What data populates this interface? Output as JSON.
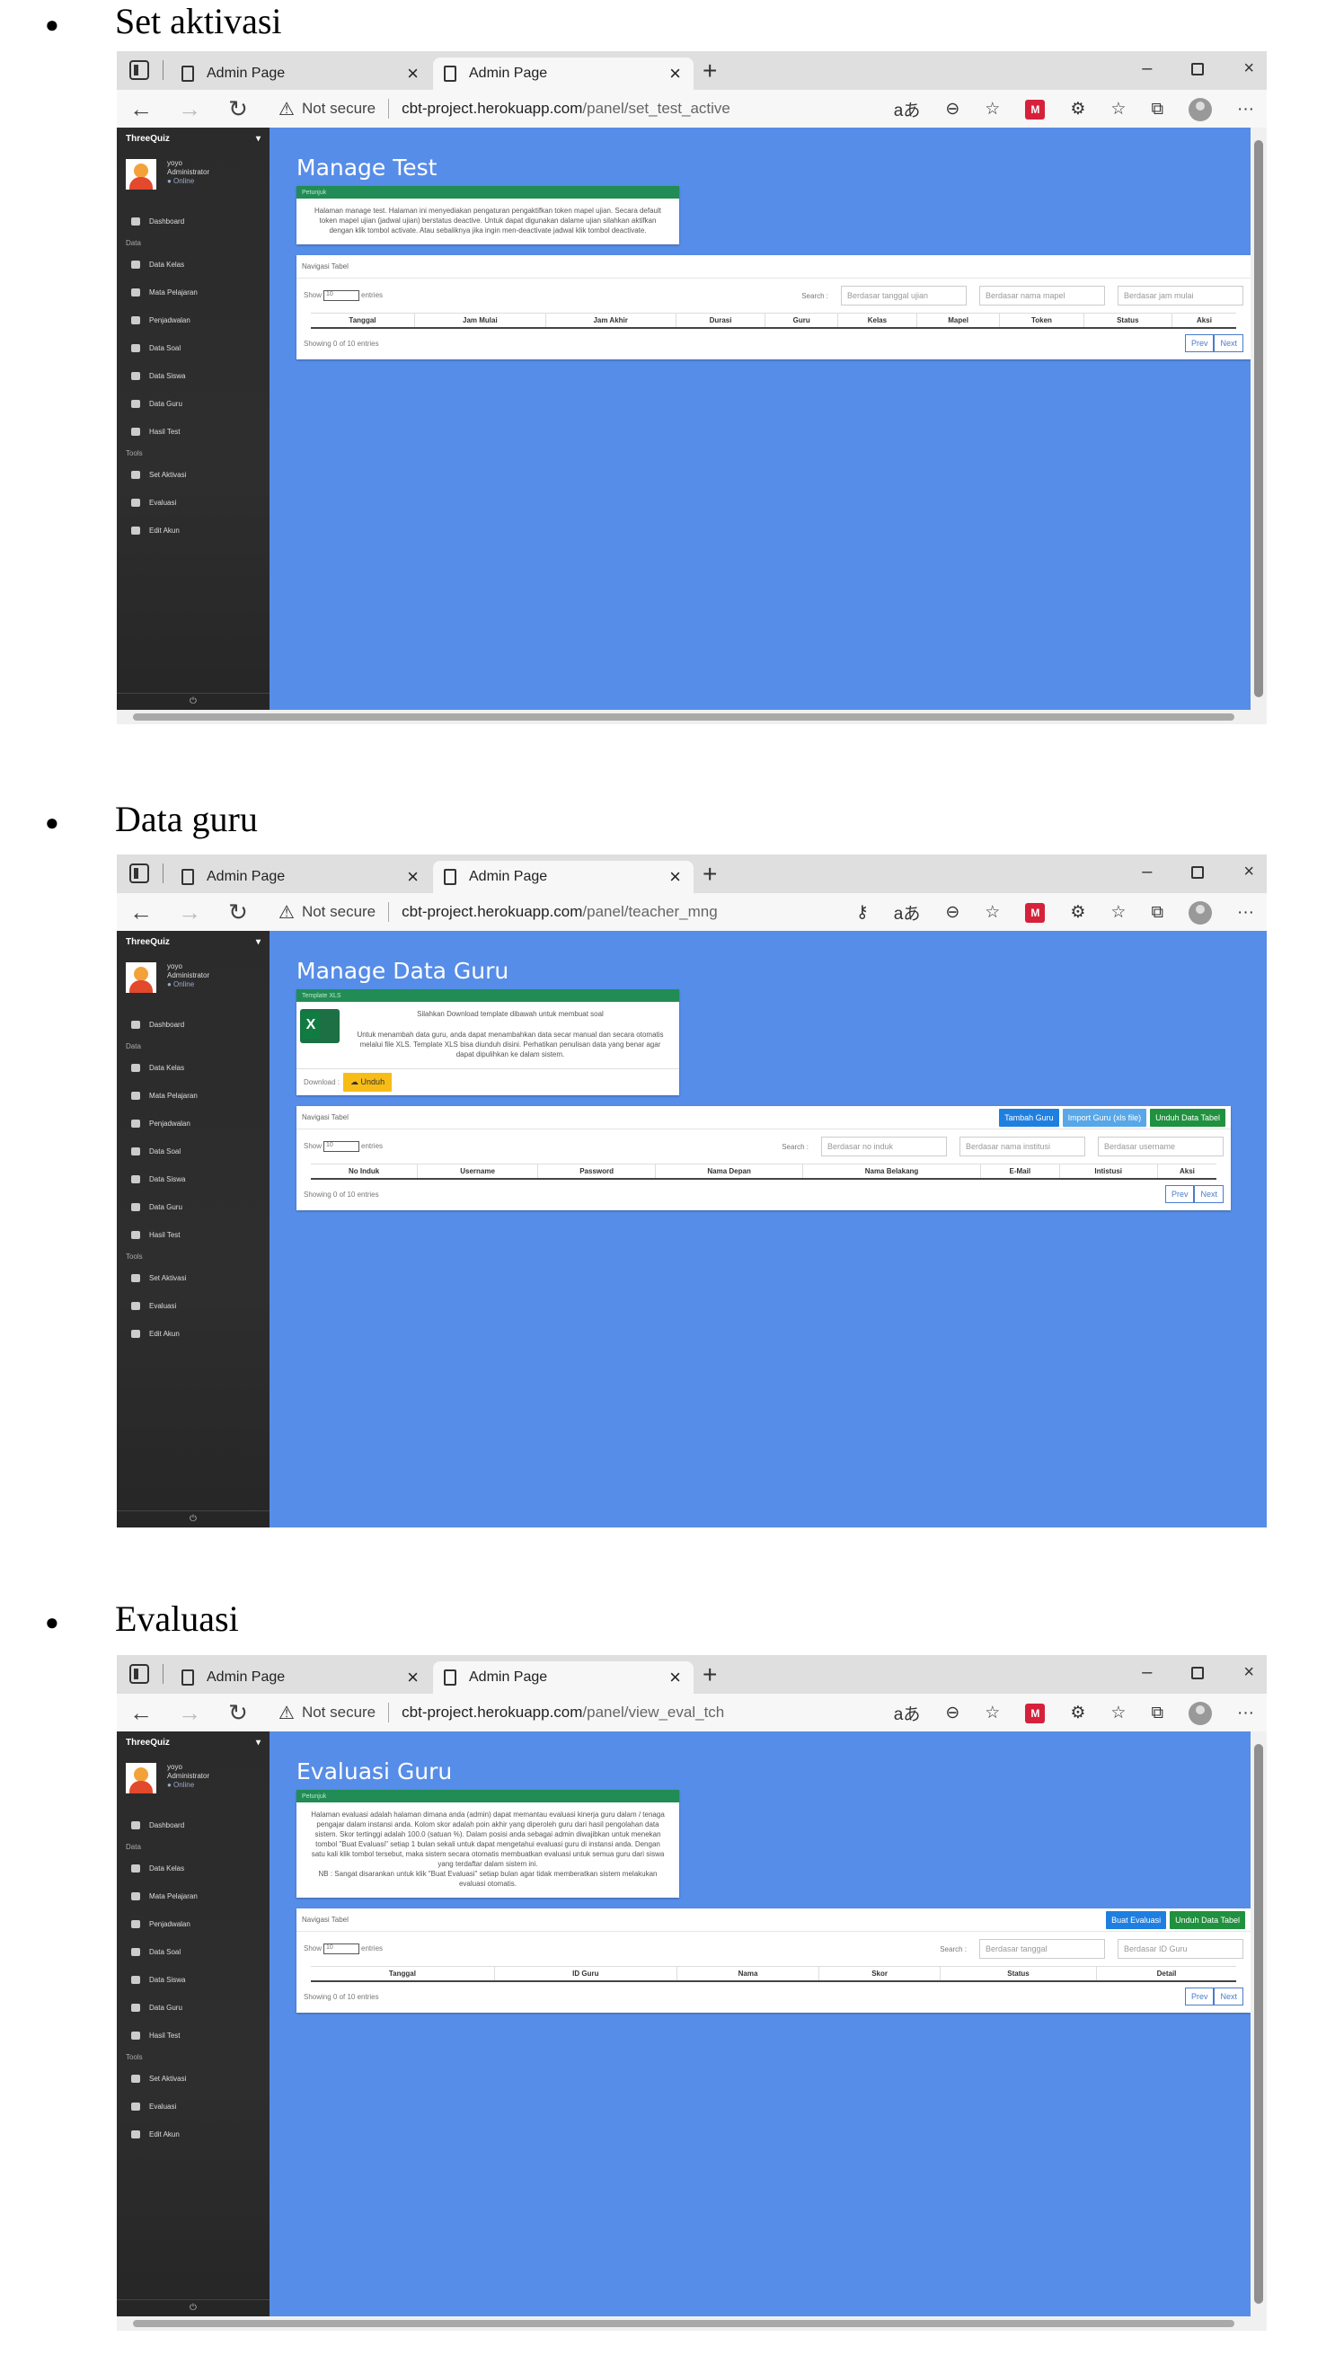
{
  "sections": [
    {
      "heading": "Set aktivasi",
      "tab_inactive": "Admin Page",
      "tab_active": "Admin Page",
      "not_secure": "Not secure",
      "url_host": "cbt-project.herokuapp.com",
      "url_path": "/panel/set_test_active",
      "title": "Manage Test",
      "info_head": "Petunjuk",
      "info_text": "Halaman manage test. Halaman ini menyediakan pengaturan pengaktifkan token mapel ujian. Secara default token mapel ujian (jadwal ujian) berstatus deactive. Untuk dapat digunakan dalame ujian silahkan aktifkan dengan klik tombol activate. Atau sebaliknya jika ingin men-deactivate jadwal klik tombol deactivate.",
      "table_head": "Navigasi Tabel",
      "show_label": "Show",
      "show_value": "10",
      "entries_label": "entries",
      "search_label": "Search :",
      "filters": [
        "Berdasar tanggal ujian",
        "Berdasar nama mapel",
        "Berdasar jam mulai"
      ],
      "columns": [
        "Tanggal",
        "Jam Mulai",
        "Jam Akhir",
        "Durasi",
        "Guru",
        "Kelas",
        "Mapel",
        "Token",
        "Status",
        "Aksi"
      ],
      "showing": "Showing 0 of 10 entries",
      "prev": "Prev",
      "next": "Next"
    },
    {
      "heading": "Data guru",
      "tab_inactive": "Admin Page",
      "tab_active": "Admin Page",
      "not_secure": "Not secure",
      "url_host": "cbt-project.herokuapp.com",
      "url_path": "/panel/teacher_mng",
      "title": "Manage Data Guru",
      "info_head": "Template XLS",
      "info_lead": "Silahkan Download template dibawah untuk membuat soal",
      "info_text": "Untuk menambah data guru, anda dapat menambahkan data secar manual dan secara otomatis melalui file XLS. Template XLS bisa diunduh disini. Perhatikan penulisan data yang benar agar dapat dipulihkan ke dalam sistem.",
      "download_label": "Download :",
      "unduh_label": "Unduh",
      "table_head": "Navigasi Tabel",
      "buttons": [
        "Tambah Guru",
        "Import Guru (xls file)",
        "Unduh Data Tabel"
      ],
      "show_label": "Show",
      "show_value": "10",
      "entries_label": "entries",
      "search_label": "Search :",
      "filters": [
        "Berdasar no induk",
        "Berdasar nama institusi",
        "Berdasar username"
      ],
      "columns": [
        "No Induk",
        "Username",
        "Password",
        "Nama Depan",
        "Nama Belakang",
        "E-Mail",
        "Intistusi",
        "Aksi"
      ],
      "showing": "Showing 0 of 10 entries",
      "prev": "Prev",
      "next": "Next"
    },
    {
      "heading": "Evaluasi",
      "tab_inactive": "Admin Page",
      "tab_active": "Admin Page",
      "not_secure": "Not secure",
      "url_host": "cbt-project.herokuapp.com",
      "url_path": "/panel/view_eval_tch",
      "title": "Evaluasi Guru",
      "info_head": "Petunjuk",
      "info_text": "Halaman evaluasi adalah halaman dimana anda (admin) dapat memantau evaluasi kinerja guru dalam / tenaga pengajar dalam instansi anda. Kolom skor adalah poin akhir yang diperoleh guru dari hasil pengolahan data sistem. Skor tertinggi adalah 100.0 (satuan %). Dalam posisi anda sebagai admin diwajibkan untuk menekan tombol \"Buat Evaluasi\" setiap 1 bulan sekali untuk dapat mengetahui evaluasi guru di instansi anda. Dengan satu kali klik tombol tersebut, maka sistem secara otomatis membuatkan evaluasi untuk semua guru dari siswa yang terdaftar dalam sistem ini.",
      "info_note": "NB : Sangat disarankan untuk klik \"Buat Evaluasi\" setiap bulan agar tidak memberatkan sistem melakukan evaluasi otomatis.",
      "table_head": "Navigasi Tabel",
      "buttons": [
        "Buat Evaluasi",
        "Unduh Data Tabel"
      ],
      "show_label": "Show",
      "show_value": "10",
      "entries_label": "entries",
      "search_label": "Search :",
      "filters": [
        "Berdasar tanggal",
        "Berdasar ID Guru"
      ],
      "columns": [
        "Tanggal",
        "ID Guru",
        "Nama",
        "Skor",
        "Status",
        "Detail"
      ],
      "showing": "Showing 0 of 10 entries",
      "prev": "Prev",
      "next": "Next"
    }
  ],
  "sidebar": {
    "brand": "ThreeQuiz",
    "pin": "▾",
    "user_name": "yoyo",
    "user_role": "Administrator",
    "user_status": "● Online",
    "dashboard": "Dashboard",
    "group_data": "Data",
    "data_items": [
      "Data Kelas",
      "Mata Pelajaran",
      "Penjadwalan",
      "Data Soal",
      "Data Siswa",
      "Data Guru",
      "Hasil Test"
    ],
    "group_tools": "Tools",
    "tool_items": [
      "Set Aktivasi",
      "Evaluasi",
      "Edit Akun"
    ],
    "footer": "⏻"
  },
  "icons": {
    "back": "←",
    "forward": "→",
    "reload": "↻",
    "warning": "⚠",
    "new_tab": "+",
    "close": "×",
    "minimize": "–",
    "more": "···"
  },
  "colors": {
    "page_bg": "#568de8",
    "sidebar_bg": "#2b2b2b",
    "card_header": "#218c55",
    "btn_blue": "#1f7fe0",
    "btn_green": "#20913e",
    "btn_yellow": "#f8bc17"
  }
}
